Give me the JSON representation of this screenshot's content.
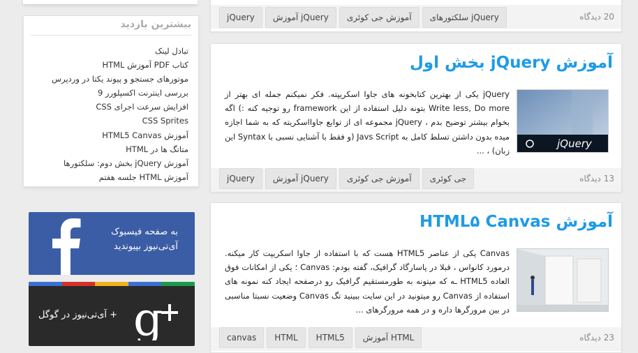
{
  "sidebar": {
    "most_visited": {
      "title": "بیشترین بازدید",
      "items": [
        "تبادل لینک",
        "کتاب PDF آموزش HTML",
        "موتورهای جستجو و پیوند یکتا در وردپرس",
        "بررسی اینترنت اکسپلورر 9",
        "افزایش سرعت اجرای CSS",
        "CSS Sprites",
        "آموزش HTML5 Canvas",
        "متاتگ ها در HTML",
        "آموزش jQuery بخش دوم: سلکتورها",
        "آموزش HTML جلسه هفتم"
      ]
    },
    "facebook": {
      "line1": "به صفحه فیسبوک",
      "line2": "آی‌تی‌نیوز بپیوندید",
      "icon": "facebook-f-icon",
      "color": "#3b5da5"
    },
    "googleplus": {
      "text": "+ آی‌تی‌نیوز در گوگل",
      "icon": "google-plus-icon",
      "bar_colors": [
        "#3b6fd1",
        "#d4312a",
        "#f2b21b",
        "#3b6fd1",
        "#1e9a4a"
      ]
    }
  },
  "posts": [
    {
      "comments": "20 دیدگاه",
      "tags": [
        "سلکتورهای jQuery",
        "آموزش جی کوئری",
        "آموزش jQuery",
        "jQuery"
      ]
    },
    {
      "title": "آموزش jQuery بخش اول",
      "thumb_label": "jQuery",
      "excerpt": "jQuery یکی از بهترین کتابخونه های جاوا اسکریپته. فکر نمیکنم جمله ای بهتر از Write less, Do more بتونه دلیل استفاده از این framework رو توجیه کنه :) اگه بخوام بیشتر توضیح بدم ، jQuery مجموعه ای از توابع جاوااسکریته که به شما اجازه میده بدون داشتن تسلط کامل به Javs Script (و فقط با آشنایی نسبی با Syntax این زبان) ، ...",
      "comments": "13 دیدگاه",
      "tags": [
        "جی کوئری",
        "آموزش جی کوئری",
        "آموزش jQuery",
        "jQuery"
      ]
    },
    {
      "title": "آموزش HTML۵ Canvas",
      "excerpt": "Canvas یکی از عناصر HTML5 هست که با استفاده از جاوا اسکریپت کار میکنه. درمورد کانواس ، قبلا در پاسارگاد گرافیک، گفته بودم: Canvas ؛ یکی از امکانات فوق العاده HTML5 ـه که میتونه به طورمستقیم گرافیک رو درصفحه ایجاد کنه نمونه های استفاده از Canvas رو میتونید در این سایت ببینید تگ Canvas وضعیت نسبتا مناسبی در بین مرورگرها داره و در همه مرورگرهای ...",
      "comments": "23 دیدگاه",
      "tags": [
        "آموزش HTML",
        "HTML5",
        "HTML",
        "canvas"
      ]
    }
  ]
}
